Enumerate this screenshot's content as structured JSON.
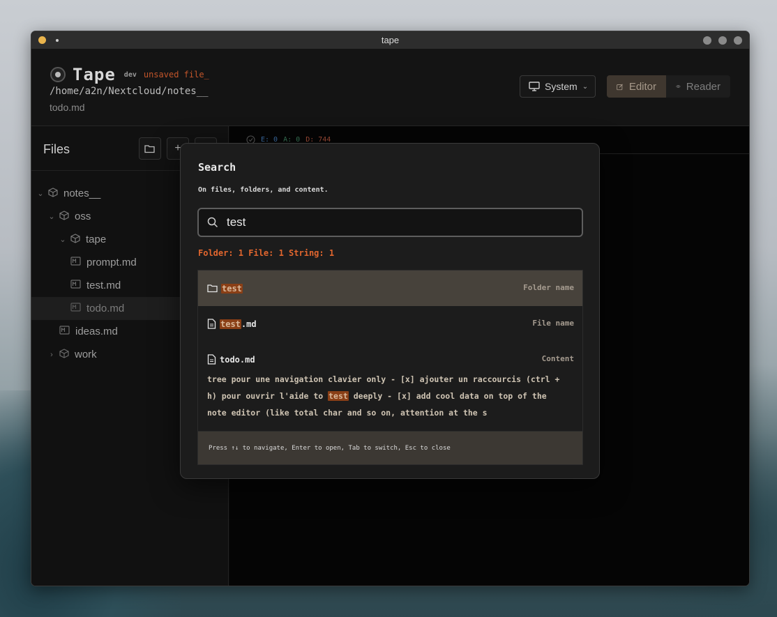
{
  "window": {
    "title": "tape"
  },
  "header": {
    "brand": "Tape",
    "env_badge": "dev",
    "unsaved_label": "unsaved file_",
    "path": "/home/a2n/Nextcloud/notes__",
    "current_file": "todo.md",
    "theme_select": {
      "label": "System",
      "icon": "monitor-icon"
    },
    "view_modes": [
      {
        "label": "Editor",
        "icon": "pencil-square-icon",
        "active": true
      },
      {
        "label": "Reader",
        "icon": "eye-icon",
        "active": false
      }
    ]
  },
  "sidebar": {
    "title": "Files",
    "tree": [
      {
        "label": "notes__",
        "depth": 0,
        "type": "folder",
        "expanded": true
      },
      {
        "label": "oss",
        "depth": 1,
        "type": "folder",
        "expanded": true
      },
      {
        "label": "tape",
        "depth": 2,
        "type": "folder",
        "expanded": true
      },
      {
        "label": "prompt.md",
        "depth": 3,
        "type": "file"
      },
      {
        "label": "test.md",
        "depth": 3,
        "type": "file"
      },
      {
        "label": "todo.md",
        "depth": 3,
        "type": "file",
        "active": true
      },
      {
        "label": "ideas.md",
        "depth": 2,
        "type": "file"
      },
      {
        "label": "work",
        "depth": 1,
        "type": "folder",
        "expanded": false
      }
    ]
  },
  "status": {
    "e": "E: 0",
    "a": "A: 0",
    "d": "D: 744"
  },
  "search": {
    "title": "Search",
    "subtitle": "On files, folders, and content.",
    "query": "test",
    "counts": "Folder: 1 File: 1 String: 1",
    "results": [
      {
        "icon": "folder-icon",
        "name_hl": "test",
        "name_rest": "",
        "type": "Folder name",
        "selected": true
      },
      {
        "icon": "file-icon",
        "name_hl": "test",
        "name_rest": ".md",
        "type": "File name",
        "selected": false
      },
      {
        "icon": "file-icon",
        "name_hl": "",
        "name_rest": "todo.md",
        "type": "Content",
        "selected": false,
        "snippet_before": "tree pour une navigation clavier only - [x] ajouter un raccourcis (ctrl + h) pour ouvrir l'aide to ",
        "snippet_hl": "test",
        "snippet_after": " deeply - [x] add cool data on top of the note editor (like total char and so on, attention at the s"
      }
    ],
    "footer": "Press ↑↓ to navigate, Enter to open, Tab to switch, Esc to close"
  }
}
